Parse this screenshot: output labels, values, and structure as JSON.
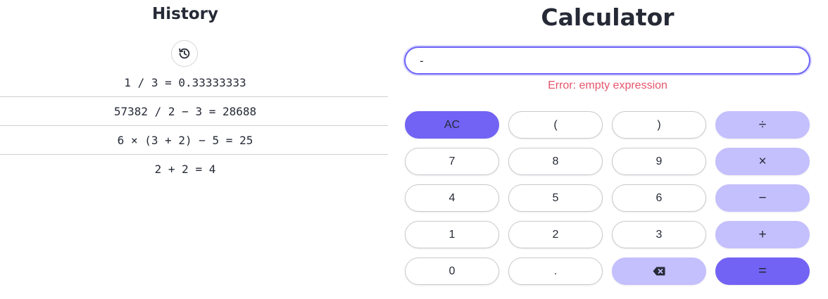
{
  "history": {
    "title": "History",
    "button_icon": "history-icon",
    "items": [
      "1 / 3 = 0.33333333",
      "57382 / 2 − 3 = 28688",
      "6 × (3 + 2) − 5 = 25",
      "2 + 2 = 4"
    ]
  },
  "calculator": {
    "title": "Calculator",
    "input_value": "-",
    "error": "Error: empty expression",
    "keys": [
      {
        "label": "AC",
        "kind": "primary"
      },
      {
        "label": "(",
        "kind": "plain"
      },
      {
        "label": ")",
        "kind": "plain"
      },
      {
        "label": "÷",
        "kind": "op"
      },
      {
        "label": "7",
        "kind": "plain"
      },
      {
        "label": "8",
        "kind": "plain"
      },
      {
        "label": "9",
        "kind": "plain"
      },
      {
        "label": "×",
        "kind": "op"
      },
      {
        "label": "4",
        "kind": "plain"
      },
      {
        "label": "5",
        "kind": "plain"
      },
      {
        "label": "6",
        "kind": "plain"
      },
      {
        "label": "−",
        "kind": "op"
      },
      {
        "label": "1",
        "kind": "plain"
      },
      {
        "label": "2",
        "kind": "plain"
      },
      {
        "label": "3",
        "kind": "plain"
      },
      {
        "label": "+",
        "kind": "op"
      },
      {
        "label": "0",
        "kind": "plain"
      },
      {
        "label": ".",
        "kind": "plain"
      },
      {
        "label": "",
        "kind": "op",
        "icon": "backspace-icon"
      },
      {
        "label": "=",
        "kind": "primary"
      }
    ]
  },
  "colors": {
    "accent": "#7363f4",
    "accent_light": "#c4bffd",
    "error": "#e5566c",
    "text": "#262a36"
  }
}
